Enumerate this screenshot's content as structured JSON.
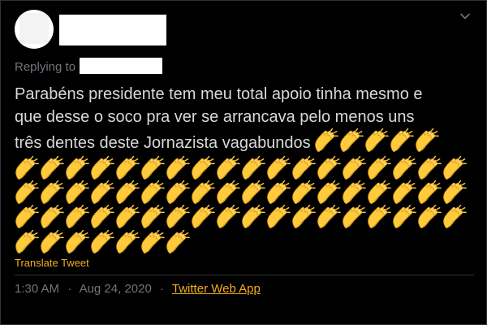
{
  "tweet": {
    "replying_prefix": "Replying to",
    "text_lines": [
      "Parabéns presidente tem meu total apoio tinha mesmo e",
      "que desse o soco pra ver se  arrancava pelo menos uns",
      "três dentes deste Jornazista vagabundos"
    ],
    "emoji": "clapping-hands",
    "emoji_counts": {
      "inline_after_text": 5,
      "rows": [
        18,
        18,
        18,
        7
      ],
      "total": 66
    },
    "translate_label": "Translate Tweet",
    "time": "1:30 AM",
    "separator": "·",
    "date": "Aug 24, 2020",
    "source": "Twitter Web App"
  },
  "icons": {
    "caret": "chevron-down-icon",
    "clap": "clapping-hands-icon"
  },
  "colors": {
    "background": "#000000",
    "text": "#d9d9d9",
    "secondary_text": "#6e767d",
    "accent": "#f4ad1f",
    "redaction": "#ffffff"
  }
}
